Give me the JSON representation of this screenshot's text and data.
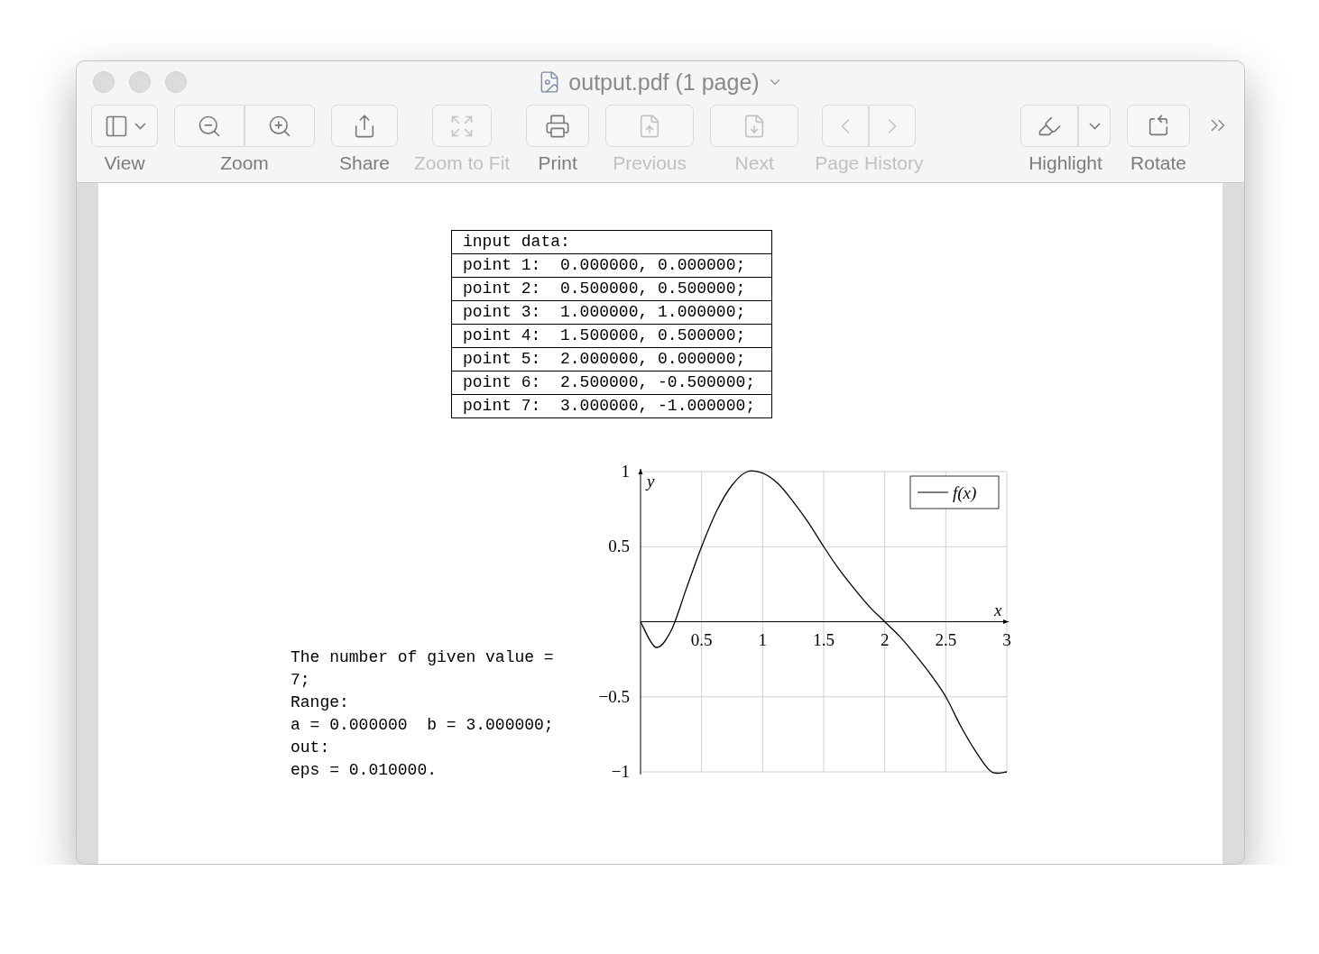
{
  "window": {
    "title": "output.pdf (1 page)"
  },
  "toolbar": [
    {
      "label": "View",
      "disabled": false
    },
    {
      "label": "Zoom",
      "disabled": false
    },
    {
      "label": "Share",
      "disabled": false
    },
    {
      "label": "Zoom to Fit",
      "disabled": true
    },
    {
      "label": "Print",
      "disabled": false
    },
    {
      "label": "Previous",
      "disabled": true
    },
    {
      "label": "Next",
      "disabled": true
    },
    {
      "label": "Page History",
      "disabled": true
    },
    {
      "label": "Highlight",
      "disabled": false
    },
    {
      "label": "Rotate",
      "disabled": false
    }
  ],
  "document": {
    "input_table": {
      "header": "input data:",
      "rows": [
        "point 1:  0.000000, 0.000000;",
        "point 2:  0.500000, 0.500000;",
        "point 3:  1.000000, 1.000000;",
        "point 4:  1.500000, 0.500000;",
        "point 5:  2.000000, 0.000000;",
        "point 6:  2.500000, -0.500000;",
        "point 7:  3.000000, -1.000000;"
      ]
    },
    "result_lines": [
      "The number of given value =",
      "7;",
      "Range:",
      "a = 0.000000  b = 3.000000;",
      "out:",
      "eps = 0.010000."
    ],
    "chart_data": {
      "type": "line",
      "grid": true,
      "xlabel": "x",
      "ylabel": "y",
      "x": [
        0,
        0.125,
        0.25,
        0.375,
        0.5,
        0.625,
        0.75,
        0.875,
        1,
        1.125,
        1.25,
        1.375,
        1.5,
        1.625,
        1.75,
        1.875,
        2,
        2.125,
        2.25,
        2.375,
        2.5,
        2.625,
        2.75,
        2.875,
        3
      ],
      "series": [
        {
          "name": "f(x)",
          "color": "#000000",
          "values": [
            0,
            -0.17,
            -0.06,
            0.22,
            0.5,
            0.74,
            0.91,
            1.0,
            0.99,
            0.92,
            0.8,
            0.66,
            0.5,
            0.35,
            0.22,
            0.1,
            0,
            -0.1,
            -0.22,
            -0.35,
            -0.5,
            -0.7,
            -0.87,
            -1.0,
            -1.0
          ]
        }
      ],
      "xlim": [
        0,
        3
      ],
      "ylim": [
        -1,
        1
      ],
      "xticks": [
        0.5,
        1,
        1.5,
        2,
        2.5,
        3
      ],
      "yticks": [
        {
          "value": -1,
          "label": "−1"
        },
        {
          "value": -0.5,
          "label": "−0.5"
        },
        {
          "value": 0.5,
          "label": "0.5"
        },
        {
          "value": 1,
          "label": "1"
        }
      ]
    }
  }
}
